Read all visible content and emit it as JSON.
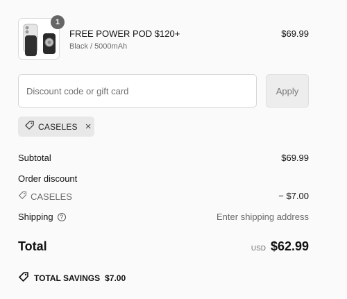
{
  "product": {
    "quantity": "1",
    "name": "FREE POWER POD $120+",
    "variant": "Black / 5000mAh",
    "price": "$69.99"
  },
  "discount": {
    "placeholder": "Discount code or gift card",
    "apply_label": "Apply",
    "applied_code": "CASELES"
  },
  "summary": {
    "subtotal_label": "Subtotal",
    "subtotal_value": "$69.99",
    "order_discount_label": "Order discount",
    "discount_code": "CASELES",
    "discount_value": "− $7.00",
    "shipping_label": "Shipping",
    "shipping_value": "Enter shipping address",
    "total_label": "Total",
    "currency": "USD",
    "total_value": "$62.99"
  },
  "savings": {
    "label": "TOTAL SAVINGS",
    "value": "$7.00"
  },
  "icons": {
    "help": "?",
    "remove": "×"
  },
  "colors": {
    "background": "#fafafa",
    "muted_text": "#6b6b6b",
    "badge": "#666666"
  }
}
